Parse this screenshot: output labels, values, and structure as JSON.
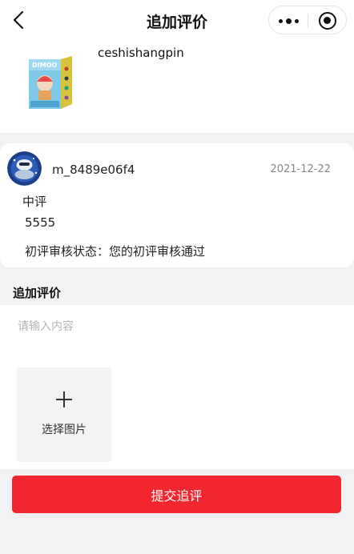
{
  "navbar": {
    "title": "追加评价",
    "icons": {
      "back": "back-arrow-icon",
      "more": "more-dots-icon",
      "close": "target-circle-icon"
    }
  },
  "product": {
    "name": "ceshishangpin",
    "image": "product-box-image"
  },
  "review": {
    "username": "m_8489e06f4",
    "date": "2021-12-22",
    "rating": "中评",
    "content": "5555",
    "audit_status": "初评审核状态：您的初评审核通过"
  },
  "add_review": {
    "heading": "追加评价",
    "placeholder": "请输入内容",
    "picker_label": "选择图片"
  },
  "submit": {
    "label": "提交追评"
  },
  "colors": {
    "accent": "#f1262f",
    "background": "#f2f2f4",
    "muted_text": "#888888"
  }
}
